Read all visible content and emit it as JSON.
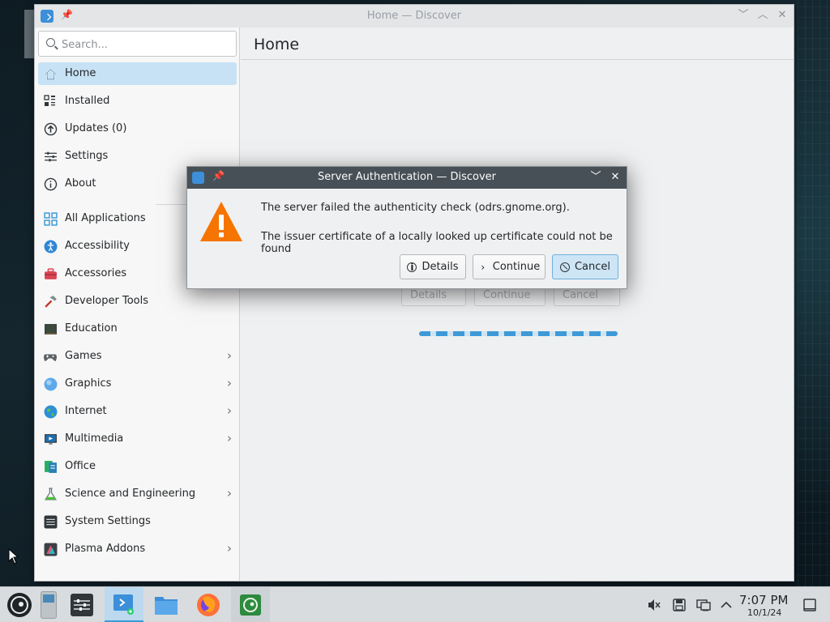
{
  "window": {
    "title": "Home — Discover",
    "controls": [
      "minimize-icon",
      "maximize-icon",
      "close-icon"
    ]
  },
  "sidebar": {
    "search_placeholder": "Search...",
    "primary": [
      {
        "label": "Home",
        "icon": "home-icon",
        "active": true
      },
      {
        "label": "Installed",
        "icon": "installed-icon"
      },
      {
        "label": "Updates (0)",
        "icon": "updates-icon"
      },
      {
        "label": "Settings",
        "icon": "settings-icon"
      },
      {
        "label": "About",
        "icon": "about-icon"
      }
    ],
    "categories": [
      {
        "label": "All Applications",
        "icon": "all-applications-icon",
        "has_submenu": false
      },
      {
        "label": "Accessibility",
        "icon": "accessibility-icon",
        "has_submenu": false
      },
      {
        "label": "Accessories",
        "icon": "accessories-icon",
        "has_submenu": false
      },
      {
        "label": "Developer Tools",
        "icon": "developer-tools-icon",
        "has_submenu": false
      },
      {
        "label": "Education",
        "icon": "education-icon",
        "has_submenu": false
      },
      {
        "label": "Games",
        "icon": "games-icon",
        "has_submenu": true
      },
      {
        "label": "Graphics",
        "icon": "graphics-icon",
        "has_submenu": true
      },
      {
        "label": "Internet",
        "icon": "internet-icon",
        "has_submenu": true
      },
      {
        "label": "Multimedia",
        "icon": "multimedia-icon",
        "has_submenu": true
      },
      {
        "label": "Office",
        "icon": "office-icon",
        "has_submenu": false
      },
      {
        "label": "Science and Engineering",
        "icon": "science-icon",
        "has_submenu": true
      },
      {
        "label": "System Settings",
        "icon": "system-settings-icon",
        "has_submenu": false
      },
      {
        "label": "Plasma Addons",
        "icon": "plasma-addons-icon",
        "has_submenu": true
      }
    ]
  },
  "main": {
    "title": "Home",
    "loading": {
      "indeterminate": true
    }
  },
  "dialog": {
    "title": "Server Authentication — Discover",
    "message_line1": "The server failed the authenticity check (odrs.gnome.org).",
    "message_line2": "The issuer certificate of a locally looked up certificate could not be found",
    "buttons": {
      "details": "Details",
      "continue": "Continue",
      "cancel": "Cancel"
    }
  },
  "taskbar": {
    "clock_time": "7:07 PM",
    "clock_date": "10/1/24",
    "launchers": [
      "application-launcher-icon",
      "pager-icon",
      "system-settings-icon",
      "discover-icon",
      "file-manager-icon",
      "firefox-icon",
      "terminal-icon"
    ],
    "tray": [
      "volume-muted-icon",
      "storage-icon",
      "network-icon",
      "expand-tray-icon",
      "show-desktop-icon"
    ]
  },
  "colors": {
    "accent": "#3d9ad8",
    "selection": "#c7e2f5",
    "dialog_titlebar": "#475057",
    "warning": "#f67400"
  }
}
